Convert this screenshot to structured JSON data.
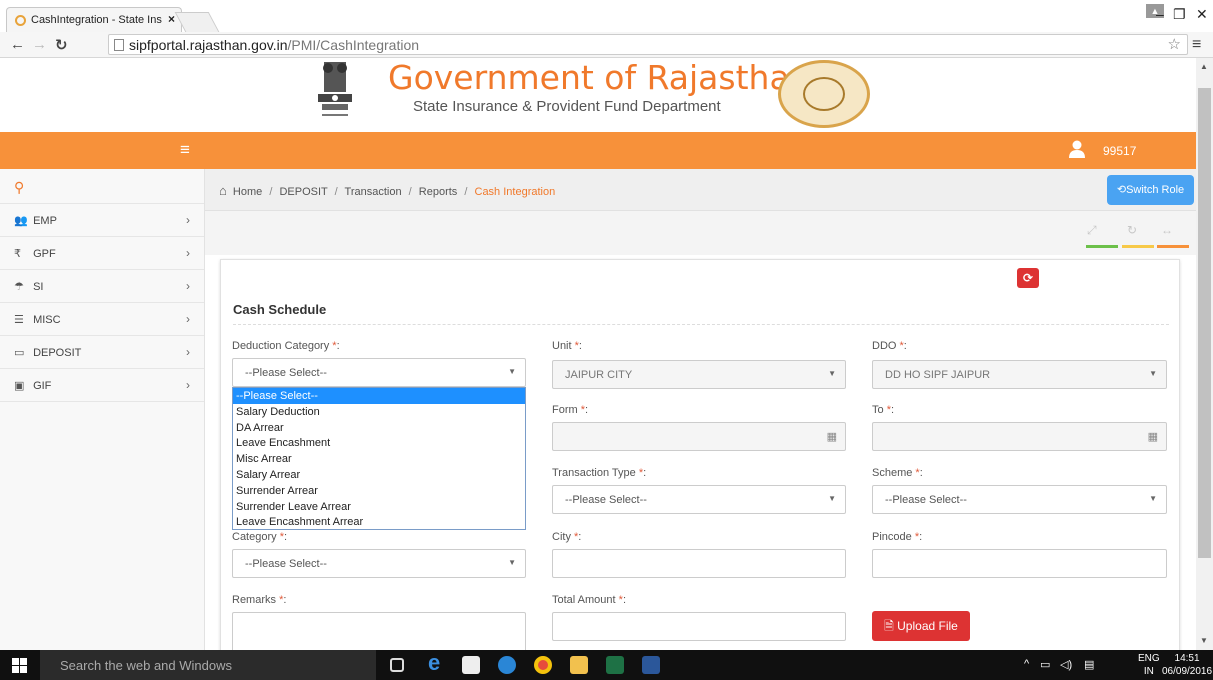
{
  "browser": {
    "tab_title": "CashIntegration - State Ins",
    "url_host": "sipfportal.rajasthan.gov.in",
    "url_path": "/PMI/CashIntegration"
  },
  "header": {
    "title": "Government of Rajasthan",
    "subtitle": "State Insurance & Provident Fund Department",
    "user_id": "99517"
  },
  "sidebar": {
    "items": [
      {
        "label": "EMP",
        "icon": "users-icon"
      },
      {
        "label": "GPF",
        "icon": "rupee-icon"
      },
      {
        "label": "SI",
        "icon": "umbrella-icon"
      },
      {
        "label": "MISC",
        "icon": "list-icon"
      },
      {
        "label": "DEPOSIT",
        "icon": "card-icon"
      },
      {
        "label": "GIF",
        "icon": "briefcase-icon"
      }
    ]
  },
  "breadcrumb": {
    "home": "Home",
    "items": [
      "DEPOSIT",
      "Transaction",
      "Reports"
    ],
    "active": "Cash Integration",
    "separator": "/"
  },
  "switch_role_label": "Switch Role",
  "form": {
    "title": "Cash Schedule",
    "required_mark": "*",
    "deduction_category": {
      "label": "Deduction Category",
      "value": "--Please Select--"
    },
    "unit": {
      "label": "Unit",
      "value": "JAIPUR CITY"
    },
    "ddo": {
      "label": "DDO",
      "value": "DD HO SIPF JAIPUR"
    },
    "form_field": {
      "label": "Form"
    },
    "to_field": {
      "label": "To"
    },
    "transaction_type": {
      "label": "Transaction Type",
      "value": "--Please Select--"
    },
    "scheme": {
      "label": "Scheme",
      "value": "--Please Select--"
    },
    "category": {
      "label": "Category",
      "value": "--Please Select--"
    },
    "city": {
      "label": "City"
    },
    "pincode": {
      "label": "Pincode"
    },
    "remarks": {
      "label": "Remarks"
    },
    "total_amount": {
      "label": "Total Amount"
    },
    "upload_label": "Upload File"
  },
  "dropdown_options": [
    "--Please Select--",
    "Salary Deduction",
    "DA Arrear",
    "Leave Encashment",
    "Misc Arrear",
    "Salary Arrear",
    "Surrender Arrear",
    "Surrender Leave Arrear",
    "Leave Encashment Arrear"
  ],
  "taskbar": {
    "search_placeholder": "Search the web and Windows",
    "lang_top": "ENG",
    "lang_bottom": "IN",
    "time": "14:51",
    "date": "06/09/2016"
  },
  "colors": {
    "accent": "#f7913a",
    "switch_role": "#4aa3f2",
    "danger": "#dd3333",
    "dropdown_selected": "#1e90ff"
  }
}
